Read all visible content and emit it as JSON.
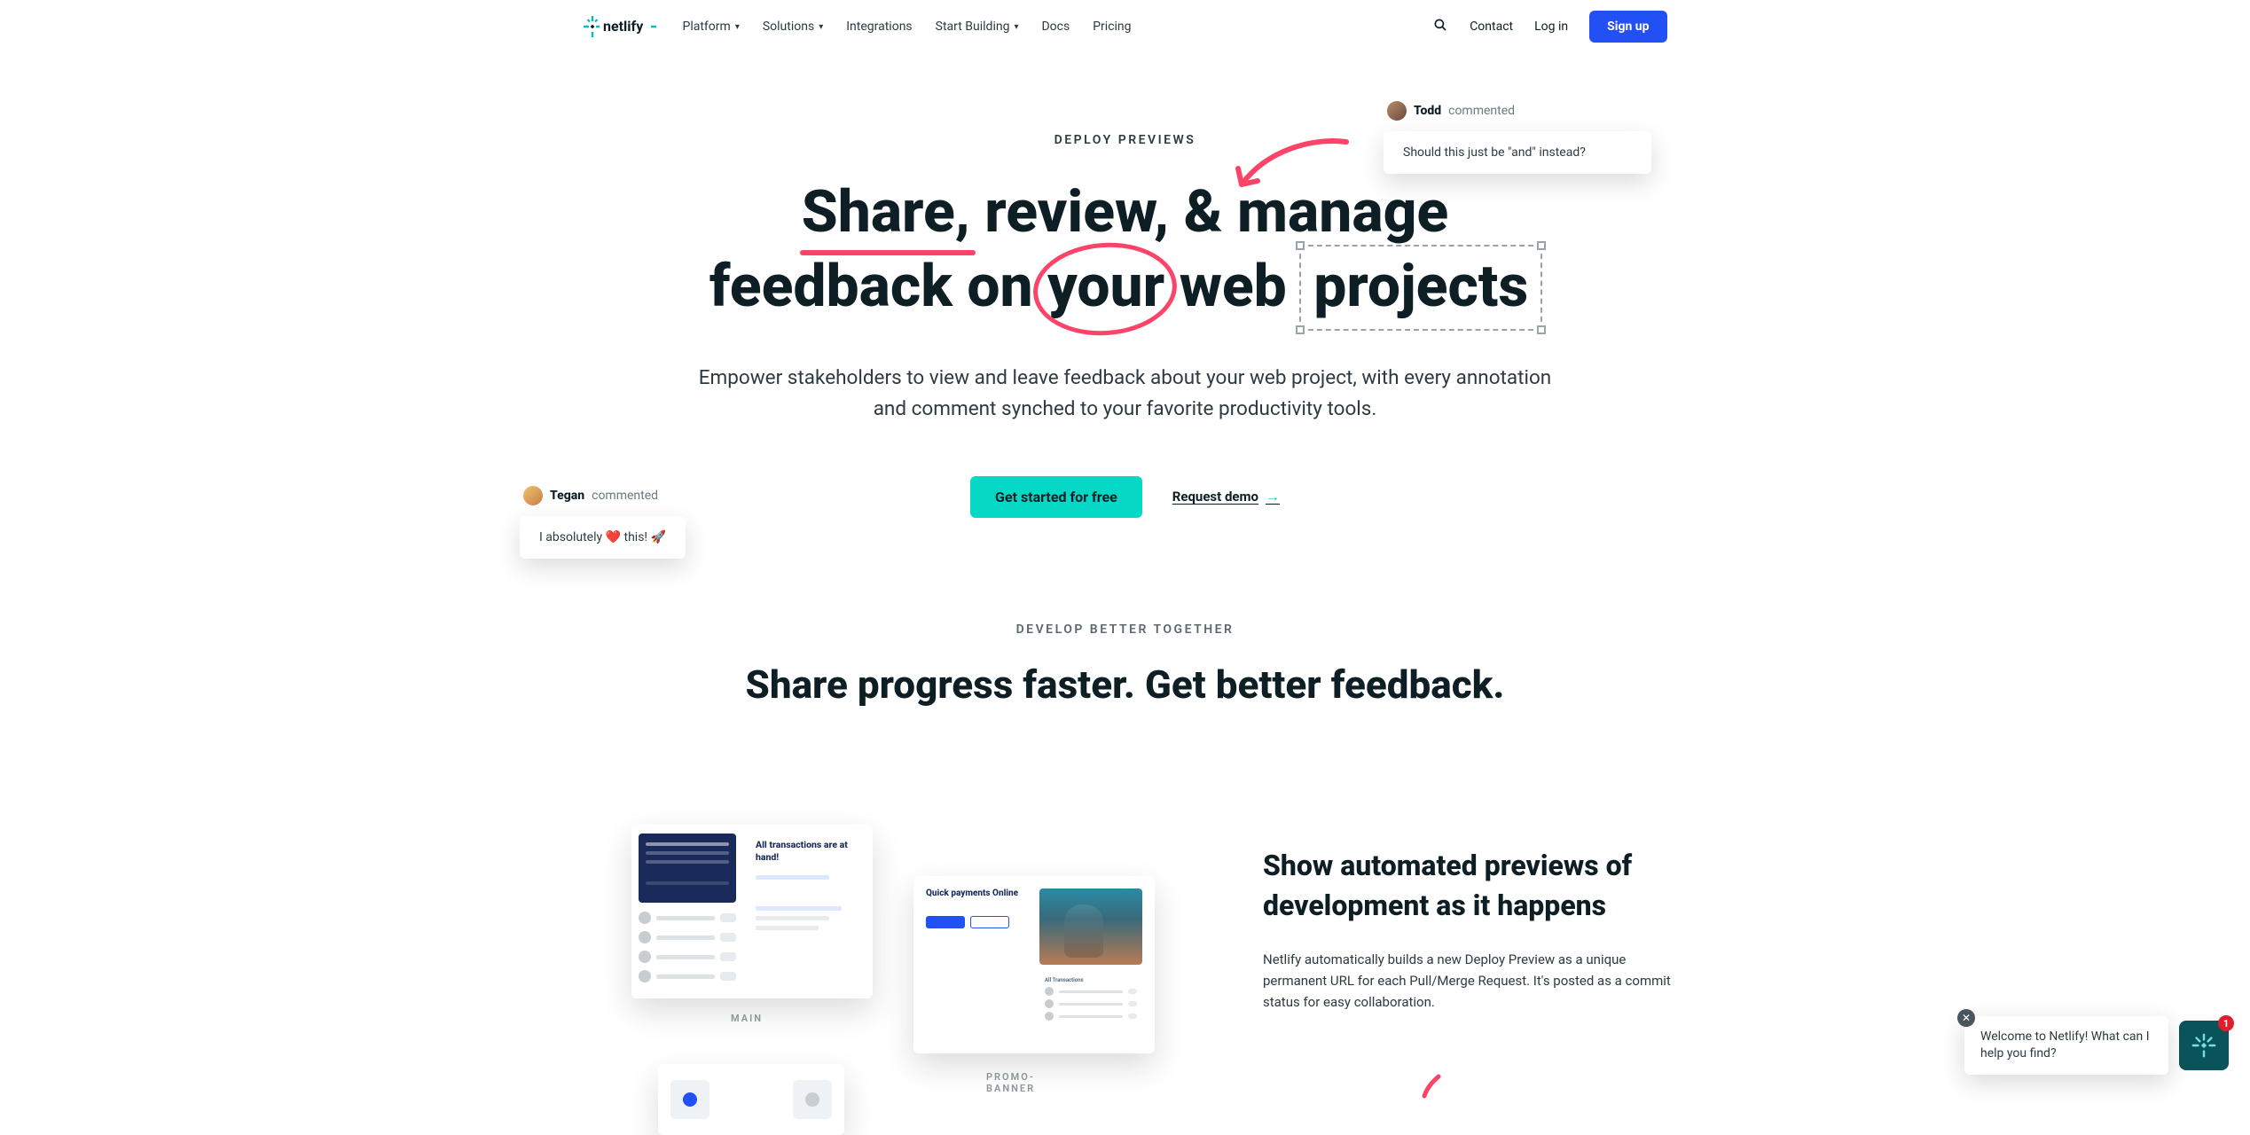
{
  "brand": {
    "name": "netlify"
  },
  "nav": {
    "items": [
      {
        "label": "Platform",
        "hasMenu": true
      },
      {
        "label": "Solutions",
        "hasMenu": true
      },
      {
        "label": "Integrations",
        "hasMenu": false
      },
      {
        "label": "Start Building",
        "hasMenu": true
      },
      {
        "label": "Docs",
        "hasMenu": false
      },
      {
        "label": "Pricing",
        "hasMenu": false
      }
    ],
    "contact": "Contact",
    "login": "Log in",
    "signup": "Sign up"
  },
  "hero": {
    "eyebrow": "DEPLOY PREVIEWS",
    "headline_words": {
      "share": "Share,",
      "review": "review,",
      "amp": "&",
      "manage": "manage",
      "feedback": "feedback",
      "on": "on",
      "your": "your",
      "web": "web",
      "projects": "projects"
    },
    "subhead": "Empower stakeholders to view and leave feedback about your web project, with every annotation and comment synched to your favorite productivity tools.",
    "cta_primary": "Get started for free",
    "cta_secondary": "Request demo"
  },
  "annotations": {
    "todd": {
      "name": "Todd",
      "action": "commented",
      "body": "Should this just be \"and\" instead?"
    },
    "tegan": {
      "name": "Tegan",
      "action": "commented",
      "body_prefix": "I absolutely ",
      "body_suffix": " this! ",
      "emoji_heart": "❤️",
      "emoji_rocket": "🚀"
    }
  },
  "section2": {
    "eyebrow": "DEVELOP BETTER TOGETHER",
    "title": "Share progress faster. Get better feedback."
  },
  "feature": {
    "title": "Show automated previews of development as it happens",
    "body": "Netlify automatically builds a new Deploy Preview as a unique permanent URL for each Pull/Merge Request. It's posted as a commit status for easy collaboration."
  },
  "mocks": {
    "main_label": "MAIN",
    "promo_label": "PROMO-BANNER",
    "main_card_title": "All transactions are at hand!",
    "promo_card_title": "Quick payments Online",
    "promo_panel_title": "All Transactions"
  },
  "chat": {
    "message": "Welcome to Netlify! What can I help you find?",
    "badge": "1"
  }
}
